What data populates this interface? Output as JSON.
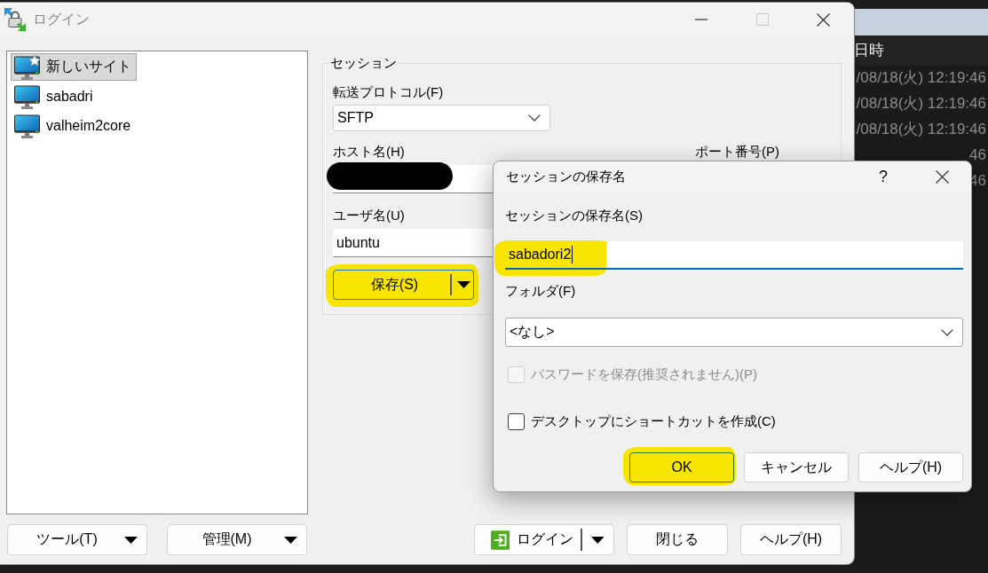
{
  "background_window": {
    "column_header": "日時",
    "rows": [
      "/08/18(火) 12:19:46",
      "/08/18(火) 12:19:46",
      "/08/18(火) 12:19:46",
      "46",
      "46"
    ]
  },
  "login_window": {
    "title": "ログイン",
    "active": false,
    "maximize_disabled": true,
    "sites": [
      {
        "label": "新しいサイト",
        "kind": "new",
        "selected": true
      },
      {
        "label": "sabadri",
        "kind": "site",
        "selected": false
      },
      {
        "label": "valheim2core",
        "kind": "site",
        "selected": false
      }
    ],
    "session": {
      "title": "セッション",
      "protocol_label": "転送プロトコル(F)",
      "protocol": "SFTP",
      "host_label": "ホスト名(H)",
      "host_redacted": true,
      "port_label": "ポート番号(P)",
      "user_label": "ユーザ名(U)",
      "user": "ubuntu",
      "save_button": {
        "label": "保存(S)",
        "highlighted": true
      }
    },
    "list_buttons": [
      {
        "label": "ツール(T)"
      },
      {
        "label": "管理(M)"
      }
    ],
    "action_buttons": [
      {
        "label": "ログイン",
        "kind": "split"
      },
      {
        "label": "閉じる",
        "kind": "plain"
      },
      {
        "label": "ヘルプ(H)",
        "kind": "plain"
      }
    ]
  },
  "dialog": {
    "title": "セッションの保存名",
    "active": true,
    "help": "?",
    "name_label": "セッションの保存名(S)",
    "name_value": "sabadori2",
    "name_focused": true,
    "name_highlighted": true,
    "folder_label": "フォルダ(F)",
    "folder": "<なし>",
    "checkboxes": [
      {
        "label": "パスワードを保存(推奨されません)(P)",
        "checked": false,
        "disabled": true
      },
      {
        "label": "デスクトップにショートカットを作成(C)",
        "checked": false,
        "disabled": false
      }
    ],
    "buttons": [
      {
        "label": "OK",
        "default": true,
        "highlighted": true
      },
      {
        "label": "キャンセル",
        "default": false,
        "highlighted": false
      },
      {
        "label": "ヘルプ(H)",
        "default": false,
        "highlighted": false
      }
    ]
  }
}
